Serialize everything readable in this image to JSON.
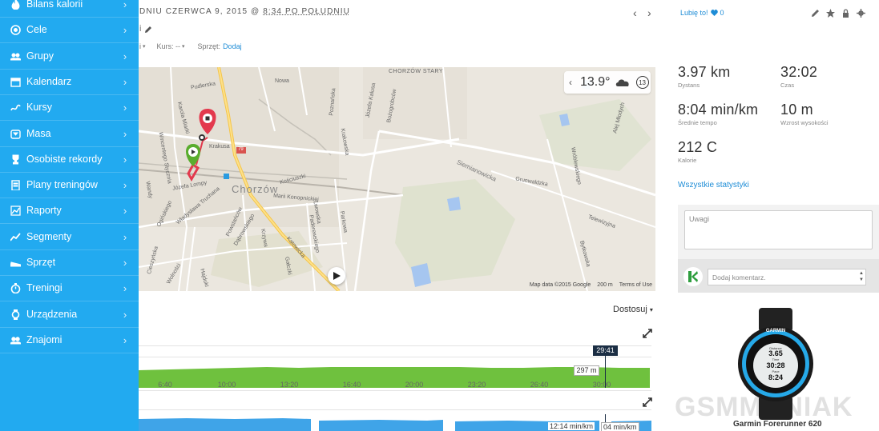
{
  "sidebar": {
    "items": [
      {
        "label": "Bilans kalorii",
        "icon": "flame-icon"
      },
      {
        "label": "Cele",
        "icon": "target-icon"
      },
      {
        "label": "Grupy",
        "icon": "group-icon"
      },
      {
        "label": "Kalendarz",
        "icon": "calendar-icon"
      },
      {
        "label": "Kursy",
        "icon": "course-icon"
      },
      {
        "label": "Masa",
        "icon": "scale-icon"
      },
      {
        "label": "Osobiste rekordy",
        "icon": "trophy-icon"
      },
      {
        "label": "Plany treningów",
        "icon": "clipboard-icon"
      },
      {
        "label": "Raporty",
        "icon": "report-icon"
      },
      {
        "label": "Segmenty",
        "icon": "segment-icon"
      },
      {
        "label": "Sprzęt",
        "icon": "shoe-icon"
      },
      {
        "label": "Treningi",
        "icon": "stopwatch-icon"
      },
      {
        "label": "Urządzenia",
        "icon": "watch-icon"
      },
      {
        "label": "Znajomi",
        "icon": "friends-icon"
      }
    ],
    "chevron": "›"
  },
  "header": {
    "date_prefix": "DNIU CZERWCA 9, 2015 @ ",
    "date_time": "8:34 PO POŁUDNIU",
    "title_fragment": "i",
    "nav_prev": "‹",
    "nav_next": "›"
  },
  "meta": {
    "first_fragment": "i",
    "caret": "▾",
    "course_label": "Kurs: --",
    "gear_label": "Sprzęt:",
    "gear_link": "Dodaj"
  },
  "map": {
    "weather_temp": "13.9°",
    "weather_prev": "‹",
    "weather_timer": "13",
    "attribution": "Map data ©2015 Google",
    "scale": "200 m",
    "terms": "Terms of Use",
    "labels": [
      "Pudlerska",
      "Nowa",
      "CHORZÓW STARY",
      "Józefa Kalusa",
      "Poznańska",
      "Karola Miarki",
      "Krakusa",
      "Wincentego Stycznia",
      "Chorzów",
      "Kościuszki",
      "Marii Konopnickiej",
      "Lwowska",
      "Parkowa",
      "Siemianowicka",
      "Grunwaldzka",
      "Telewizyjna",
      "Bytkowska",
      "Katowicka",
      "Dąbrowskiego",
      "Józefa Lompy",
      "Władysława Truchana",
      "Wolności",
      "Gałczki",
      "Krzywa",
      "Paderewskiego",
      "Wandy",
      "Cieszyńska",
      "Alej Młodych",
      "Powstańców",
      "Hajduki",
      "79",
      "Bożogrobców",
      "Wróblewskiego",
      "Krakowska",
      "Ogińskiego"
    ]
  },
  "graphs": {
    "customize": "Dostosuj",
    "customize_caret": "▾",
    "cursor_time": "29:41",
    "elevation_tip": "297 m",
    "pace_tip1": "12:14 min/km",
    "pace_tip2": "04 min/km",
    "x_ticks": [
      "6:40",
      "10:00",
      "13:20",
      "16:40",
      "20:00",
      "23:20",
      "26:40",
      "30:00"
    ],
    "elevation_color": "#6fc13e",
    "pace_color": "#3fa4e8"
  },
  "social": {
    "like_label": "Lubię to!",
    "like_count": "0"
  },
  "stats": {
    "distance": {
      "value": "3.97 km",
      "label": "Dystans"
    },
    "time": {
      "value": "32:02",
      "label": "Czas"
    },
    "pace": {
      "value": "8:04 min/km",
      "label": "Średnie tempo"
    },
    "ascent": {
      "value": "10 m",
      "label": "Wzrost wysokości"
    },
    "calories": {
      "value": "212 C",
      "label": "Kalorie"
    },
    "all_link": "Wszystkie statystyki"
  },
  "notes": {
    "placeholder": "Uwagi"
  },
  "comment": {
    "placeholder": "Dodaj komentarz."
  },
  "device": {
    "caption": "Garmin Forerunner 620",
    "brand": "GARMIN",
    "screen_values": [
      "Distance",
      "3.65",
      "Time",
      "30:28",
      "Pace",
      "8:24"
    ]
  },
  "watermark": "GSMMANIAK",
  "colors": {
    "sidebar": "#22aaf0",
    "accent_link": "#1d8cd6",
    "start_pin": "#5aad2e",
    "end_pin": "#e3394d",
    "route": "#e3394d"
  }
}
